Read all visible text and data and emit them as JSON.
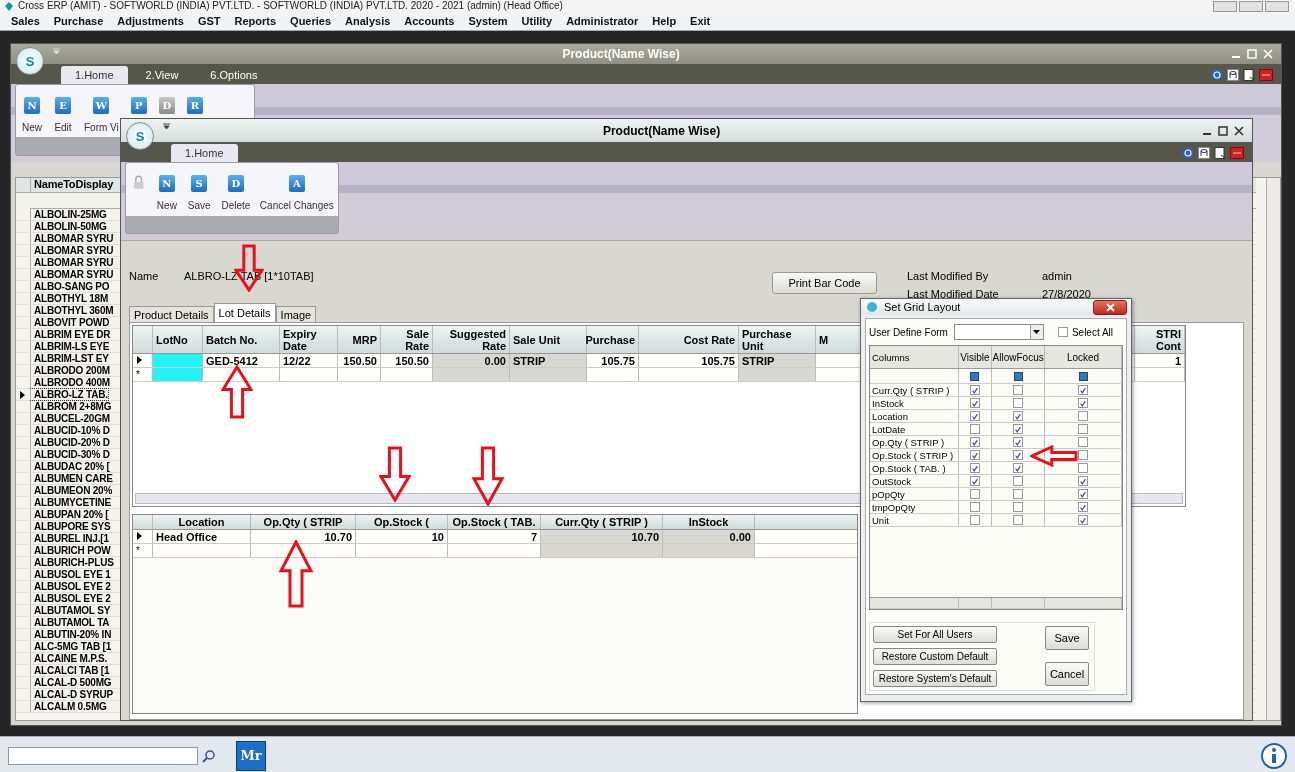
{
  "app_title": "Cross ERP (AMIT) - SOFTWORLD (INDIA) PVT.LTD. - SOFTWORLD (INDIA) PVT.LTD.  2020 - 2021 (admin) (Head Office)",
  "menu": [
    "Sales",
    "Purchase",
    "Adjustments",
    "GST",
    "Reports",
    "Queries",
    "Analysis",
    "Accounts",
    "System",
    "Utility",
    "Administrator",
    "Help",
    "Exit"
  ],
  "outer_window": {
    "title": "Product(Name Wise)",
    "logo_letter": "S",
    "tabs": [
      {
        "label": "1.Home",
        "selected": true
      },
      {
        "label": "2.View",
        "selected": false
      },
      {
        "label": "6.Options",
        "selected": false
      }
    ],
    "ribbon": [
      {
        "icon": "N",
        "label": "New",
        "disabled": false
      },
      {
        "icon": "E",
        "label": "Edit",
        "disabled": false
      },
      {
        "icon": "W",
        "label": "Form Vi",
        "disabled": false
      },
      {
        "icon": "P",
        "disabled": false
      },
      {
        "icon": "D",
        "disabled": true
      },
      {
        "icon": "R",
        "disabled": false
      }
    ],
    "list": {
      "header": "NameToDisplay",
      "rows": [
        {
          "text": "ALBOLIN-25MG",
          "selected": false
        },
        {
          "text": "ALBOLIN-50MG",
          "selected": false
        },
        {
          "text": "ALBOMAR SYRU",
          "selected": false
        },
        {
          "text": "ALBOMAR SYRU",
          "selected": false
        },
        {
          "text": "ALBOMAR SYRU",
          "selected": false
        },
        {
          "text": "ALBOMAR SYRU",
          "selected": false
        },
        {
          "text": "ALBO-SANG PO",
          "selected": false
        },
        {
          "text": "ALBOTHYL 18M",
          "selected": false
        },
        {
          "text": "ALBOTHYL 360M",
          "selected": false
        },
        {
          "text": "ALBOVIT POWD",
          "selected": false
        },
        {
          "text": "ALBRIM EYE DR",
          "selected": false
        },
        {
          "text": "ALBRIM-LS EYE",
          "selected": false
        },
        {
          "text": "ALBRIM-LST EY",
          "selected": false
        },
        {
          "text": "ALBRODO 200M",
          "selected": false
        },
        {
          "text": "ALBRODO 400M",
          "selected": false
        },
        {
          "text": "ALBRO-LZ TAB.",
          "selected": true
        },
        {
          "text": "ALBROM 2+8MG",
          "selected": false
        },
        {
          "text": "ALBUCEL-20GM",
          "selected": false
        },
        {
          "text": "ALBUCID-10% D",
          "selected": false
        },
        {
          "text": "ALBUCID-20% D",
          "selected": false
        },
        {
          "text": "ALBUCID-30% D",
          "selected": false
        },
        {
          "text": "ALBUDAC 20% [",
          "selected": false
        },
        {
          "text": "ALBUMEN CARE",
          "selected": false
        },
        {
          "text": "ALBUMEON 20%",
          "selected": false
        },
        {
          "text": "ALBUMYCETINE",
          "selected": false
        },
        {
          "text": "ALBUPAN 20% [",
          "selected": false
        },
        {
          "text": "ALBUPORE SYS",
          "selected": false
        },
        {
          "text": "ALBUREL INJ.[1",
          "selected": false
        },
        {
          "text": "ALBURICH POW",
          "selected": false
        },
        {
          "text": "ALBURICH-PLUS",
          "selected": false
        },
        {
          "text": "ALBUSOL EYE 1",
          "selected": false
        },
        {
          "text": "ALBUSOL EYE 2",
          "selected": false
        },
        {
          "text": "ALBUSOL EYE 2",
          "selected": false
        },
        {
          "text": "ALBUTAMOL SY",
          "selected": false
        },
        {
          "text": "ALBUTAMOL TA",
          "selected": false
        },
        {
          "text": "ALBUTIN-20% IN",
          "selected": false
        },
        {
          "text": "ALC-5MG TAB [1",
          "selected": false
        },
        {
          "text": "ALCAINE M.P.S.",
          "selected": false
        },
        {
          "text": "ALCALCI TAB [1",
          "selected": false
        },
        {
          "text": "ALCAL-D 500MG",
          "selected": false
        },
        {
          "text": "ALCAL-D SYRUP",
          "selected": false
        },
        {
          "text": "ALCALM 0.5MG",
          "selected": false
        }
      ]
    }
  },
  "inner_window": {
    "title": "Product(Name Wise)",
    "logo_letter": "S",
    "tabs": [
      {
        "label": "1.Home",
        "selected": true
      }
    ],
    "ribbon": [
      {
        "kind": "lock",
        "disabled": true
      },
      {
        "kind": "button",
        "icon": "N",
        "label": "New",
        "disabled": false
      },
      {
        "kind": "button",
        "icon": "S",
        "label": "Save",
        "disabled": false
      },
      {
        "kind": "button",
        "icon": "D",
        "label": "Delete",
        "disabled": false
      },
      {
        "kind": "button",
        "icon": "A",
        "label": "Cancel Changes",
        "disabled": false
      }
    ],
    "name_label": "Name",
    "name_value": "ALBRO-LZ TAB [1*10TAB]",
    "print_button": "Print Bar Code",
    "last_modified_by_label": "Last Modified By",
    "last_modified_by": "admin",
    "last_modified_date_label": "Last Modified Date",
    "last_modified_date": "27/8/2020",
    "page_tabs": [
      {
        "label": "Product Details",
        "selected": false
      },
      {
        "label": "Lot Details",
        "selected": true
      },
      {
        "label": "Image",
        "selected": false
      }
    ],
    "lot_grid": {
      "new_row_marker": "*",
      "columns": [
        {
          "label": "LotNo",
          "locked": false,
          "highlighted": true
        },
        {
          "label": "Batch No.",
          "locked": false,
          "highlighted": false
        },
        {
          "label": "Expiry Date",
          "locked": false,
          "highlighted": false
        },
        {
          "label": "MRP",
          "locked": false,
          "highlighted": false
        },
        {
          "label": "Sale Rate",
          "locked": false,
          "highlighted": false
        },
        {
          "label": "Suggested Rate",
          "locked": true,
          "highlighted": false
        },
        {
          "label": "Sale Unit",
          "locked": true,
          "highlighted": false
        },
        {
          "label": "Purchase",
          "locked": false,
          "highlighted": false
        },
        {
          "label": "Cost Rate",
          "locked": false,
          "highlighted": false
        },
        {
          "label": "Purchase Unit",
          "locked": true,
          "highlighted": false
        },
        {
          "label": "M",
          "locked": false,
          "highlighted": false
        },
        {
          "label": "STRI Cont",
          "locked": false,
          "highlighted": false
        }
      ],
      "rows": [
        {
          "current": true,
          "cells": [
            null,
            "GED-5412",
            "12/22",
            "150.50",
            "150.50",
            "0.00",
            "STRIP",
            "105.75",
            "105.75",
            "STRIP",
            null,
            "1"
          ]
        }
      ]
    },
    "stock_grid": {
      "new_row_marker": "*",
      "columns": [
        {
          "label": "Location",
          "locked": false
        },
        {
          "label": "Op.Qty ( STRIP",
          "locked": false
        },
        {
          "label": "Op.Stock (",
          "locked": false
        },
        {
          "label": "Op.Stock ( TAB.",
          "locked": false
        },
        {
          "label": "Curr.Qty ( STRIP )",
          "locked": true
        },
        {
          "label": "InStock",
          "locked": true
        }
      ],
      "rows": [
        {
          "current": true,
          "cells": [
            "Head Office",
            "10.70",
            "10",
            "7",
            "10.70",
            "0.00"
          ]
        }
      ]
    }
  },
  "dialog": {
    "title": "Set Grid Layout",
    "user_define_form_label": "User Define Form",
    "select_all": {
      "label": "Select All",
      "checked": false
    },
    "columns": [
      "Columns",
      "Visible",
      "AllowFocus",
      "Locked"
    ],
    "rows": [
      {
        "name": "Curr.Qty ( STRIP )",
        "visible": true,
        "allow_focus": false,
        "locked": true
      },
      {
        "name": "InStock",
        "visible": true,
        "allow_focus": false,
        "locked": true
      },
      {
        "name": "Location",
        "visible": true,
        "allow_focus": true,
        "locked": false
      },
      {
        "name": "LotDate",
        "visible": false,
        "allow_focus": true,
        "locked": false
      },
      {
        "name": "Op.Qty ( STRIP )",
        "visible": true,
        "allow_focus": true,
        "locked": false
      },
      {
        "name": "Op.Stock ( STRIP )",
        "visible": true,
        "allow_focus": true,
        "locked": false
      },
      {
        "name": "Op.Stock ( TAB. )",
        "visible": true,
        "allow_focus": true,
        "locked": false
      },
      {
        "name": "OutStock",
        "visible": true,
        "allow_focus": false,
        "locked": true
      },
      {
        "name": "pOpQty",
        "visible": false,
        "allow_focus": false,
        "locked": true
      },
      {
        "name": "tmpOpQty",
        "visible": false,
        "allow_focus": false,
        "locked": true
      },
      {
        "name": "Unit",
        "visible": false,
        "allow_focus": false,
        "locked": true
      }
    ],
    "buttons": [
      "Set For All Users",
      "Restore Custom Default",
      "Restore System's Default"
    ],
    "save": "Save",
    "cancel": "Cancel"
  },
  "taskbar": {
    "app_button": "Mr"
  }
}
